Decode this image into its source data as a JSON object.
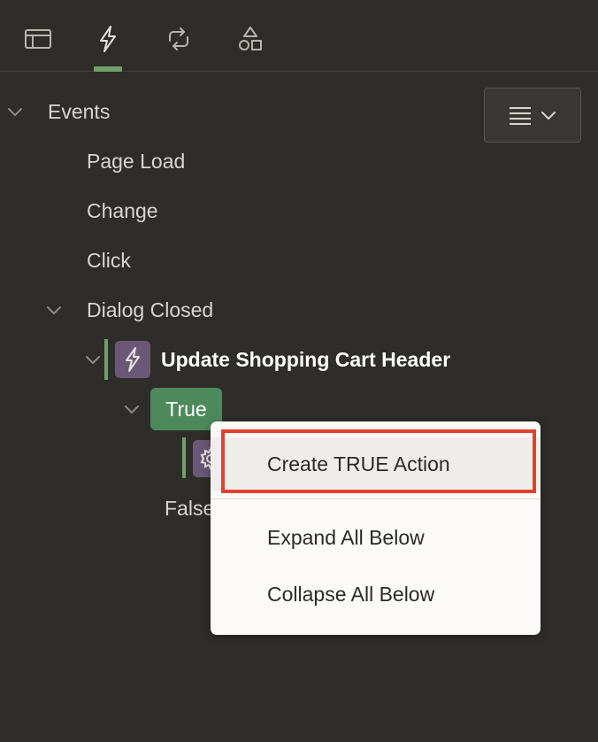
{
  "tabs": [
    {
      "name": "Rendering",
      "icon": "layout-icon"
    },
    {
      "name": "Dynamic Actions",
      "icon": "lightning-icon",
      "active": true
    },
    {
      "name": "Processing",
      "icon": "refresh-icon"
    },
    {
      "name": "Shared Components",
      "icon": "shapes-icon"
    }
  ],
  "toolbar": {
    "menu_icon": "hamburger-icon"
  },
  "tree": {
    "events_label": "Events",
    "page_load_label": "Page Load",
    "change_label": "Change",
    "click_label": "Click",
    "dialog_closed_label": "Dialog Closed",
    "dynamic_action_label": "Update Shopping Cart Header",
    "true_label": "True",
    "false_label": "False"
  },
  "context_menu": {
    "create_true_action": "Create TRUE Action",
    "expand_all_below": "Expand All Below",
    "collapse_all_below": "Collapse All Below"
  },
  "colors": {
    "background": "#2f2d2a",
    "accent_green": "#6f9f6b",
    "true_pill": "#4d8a5b",
    "action_icon": "#6b5877",
    "highlight_border": "#e2412c"
  }
}
